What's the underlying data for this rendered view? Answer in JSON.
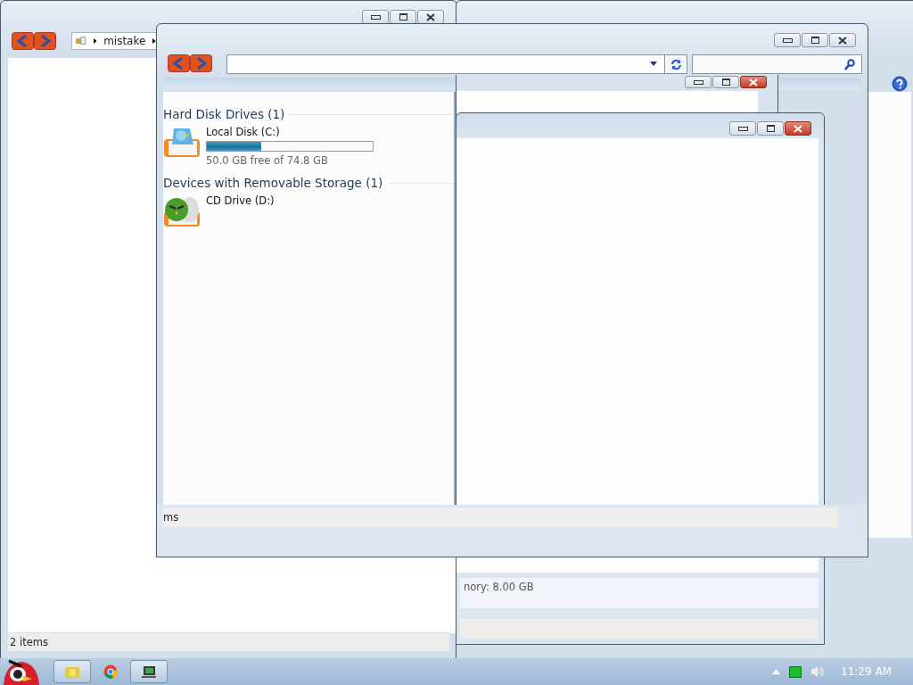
{
  "back_window_left": {
    "breadcrumb": [
      "mistake"
    ],
    "status": "2 items"
  },
  "middle_window": {
    "detail": "nory: 8.00 GB"
  },
  "front_window": {
    "groups": [
      {
        "title": "Hard Disk Drives (1)",
        "drives": [
          {
            "kind": "disk",
            "name": "Local Disk (C:)",
            "level": 0.33,
            "free": "50.0 GB free of 74.8 GB"
          }
        ]
      },
      {
        "title": "Devices with Removable Storage (1)",
        "drives": [
          {
            "kind": "cd",
            "name": "CD Drive (D:)"
          }
        ]
      }
    ],
    "status": "ms"
  },
  "taskbar": {
    "clock": "11:29 AM"
  }
}
